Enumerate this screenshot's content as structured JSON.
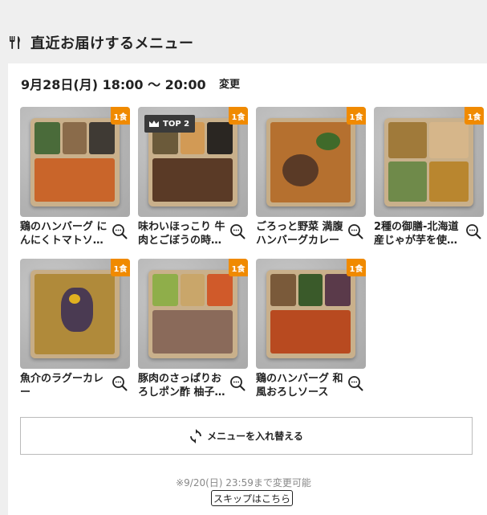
{
  "header": {
    "title": "直近お届けするメニュー",
    "icon": "fork-knife-icon"
  },
  "delivery": {
    "date_time": "9月28日(月) 18:00 〜 20:00",
    "change_label": "変更"
  },
  "menu_items": [
    {
      "name": "鶏のハンバーグ にんにくトマトソ…",
      "qty": "1食",
      "rank": ""
    },
    {
      "name": "味わいほっこり 牛肉とごぼうの時…",
      "qty": "1食",
      "rank": "TOP 2"
    },
    {
      "name": "ごろっと野菜 満腹ハンバーグカレー",
      "qty": "1食",
      "rank": ""
    },
    {
      "name": "2種の御膳-北海道産じゃが芋を使…",
      "qty": "1食",
      "rank": ""
    },
    {
      "name": "魚介のラグーカレー",
      "qty": "1食",
      "rank": ""
    },
    {
      "name": "豚肉のさっぱりおろしポン酢 柚子…",
      "qty": "1食",
      "rank": ""
    },
    {
      "name": "鶏のハンバーグ 和風おろしソース",
      "qty": "1食",
      "rank": ""
    }
  ],
  "actions": {
    "replace_label": "メニューを入れ替える",
    "deadline": "※9/20(日) 23:59まで変更可能",
    "skip_label": "スキップはこちら"
  },
  "colors": {
    "accent": "#f08a00",
    "rank_bg": "#3a3a3a",
    "page_bg": "#efefef"
  }
}
